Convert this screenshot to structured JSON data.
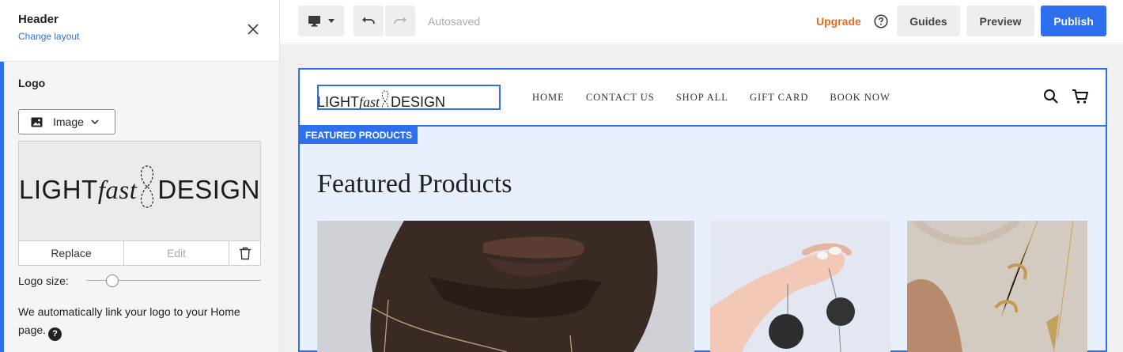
{
  "panel": {
    "title": "Header",
    "subtitle": "Change layout",
    "section_title": "Logo",
    "logo_type": "Image",
    "logo_text": {
      "part1": "LIGHT",
      "part2": "fast",
      "part3": "DESIGN"
    },
    "replace_label": "Replace",
    "edit_label": "Edit",
    "logo_size_label": "Logo size:",
    "logo_size_value": 0.15,
    "note": "We automatically link your logo to your Home page.",
    "help_glyph": "?"
  },
  "toolbar": {
    "autosaved": "Autosaved",
    "upgrade": "Upgrade",
    "guides": "Guides",
    "preview": "Preview",
    "publish": "Publish"
  },
  "site": {
    "logo_text": {
      "part1": "LIGHT",
      "part2": "fast",
      "part3": "DESIGN"
    },
    "nav": [
      "HOME",
      "CONTACT US",
      "SHOP ALL",
      "GIFT CARD",
      "BOOK NOW"
    ],
    "section_tag": "FEATURED PRODUCTS",
    "section_heading": "Featured Products"
  },
  "colors": {
    "accent": "#2e6ff0",
    "upgrade": "#ea6b1b",
    "section_bg": "#e9f0fd"
  }
}
